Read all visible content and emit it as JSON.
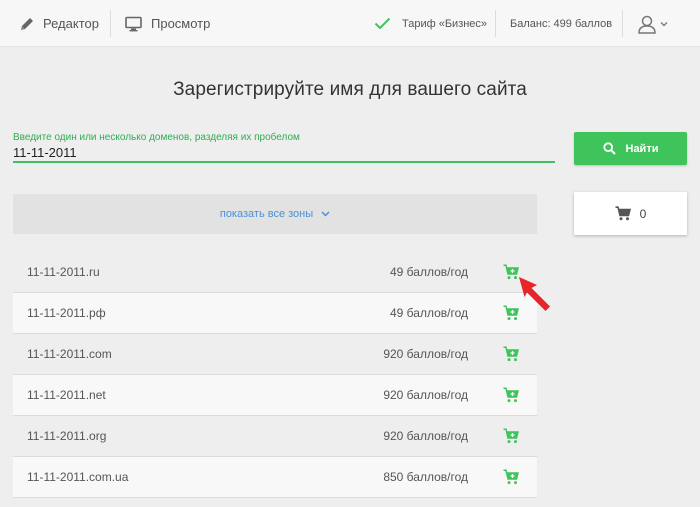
{
  "topbar": {
    "editor_label": "Редактор",
    "preview_label": "Просмотр",
    "plan_label": "Тариф «Бизнес»",
    "balance_label": "Баланс: 499 баллов"
  },
  "main": {
    "heading": "Зарегистрируйте имя для вашего сайта",
    "input_hint": "Введите один или несколько доменов, разделяя их пробелом",
    "input_value": "11-11-2011",
    "search_label": "Найти",
    "show_zones_label": "показать все зоны",
    "cart_count": "0"
  },
  "domains": [
    {
      "name": "11-11-2011.ru",
      "price": "49 баллов/год"
    },
    {
      "name": "11-11-2011.рф",
      "price": "49 баллов/год"
    },
    {
      "name": "11-11-2011.com",
      "price": "920 баллов/год"
    },
    {
      "name": "11-11-2011.net",
      "price": "920 баллов/год"
    },
    {
      "name": "11-11-2011.org",
      "price": "920 баллов/год"
    },
    {
      "name": "11-11-2011.com.ua",
      "price": "850 баллов/год"
    }
  ],
  "colors": {
    "accent_green": "#3fc45c",
    "link_blue": "#4a90d9",
    "pointer_red": "#e8232a"
  },
  "icons": {
    "editor": "pencil-icon",
    "preview": "monitor-icon",
    "plan": "checkmark-icon",
    "user": "user-icon",
    "search": "search-icon",
    "zones": "chevron-down-icon",
    "cart": "cart-icon",
    "add": "add-to-cart-icon"
  }
}
